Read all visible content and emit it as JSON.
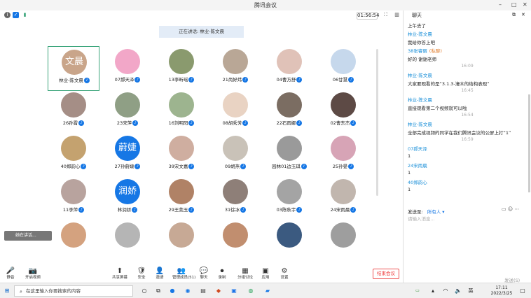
{
  "window": {
    "title": "腾讯会议"
  },
  "header": {
    "timer": "01:56:54",
    "speaking": "正在讲话: 林业-陈文晨"
  },
  "participants": [
    {
      "name": "林业-陈文晨",
      "avatar_text": "文晨",
      "selected": true
    },
    {
      "name": "07郝天泽",
      "avatar_text": ""
    },
    {
      "name": "13李昕瑶",
      "avatar_text": ""
    },
    {
      "name": "21尚好炜",
      "avatar_text": ""
    },
    {
      "name": "04曹方舒",
      "avatar_text": ""
    },
    {
      "name": "06甘慧",
      "avatar_text": ""
    },
    {
      "name": "26孙霄",
      "avatar_text": ""
    },
    {
      "name": "23宋萍",
      "avatar_text": ""
    },
    {
      "name": "16刘明阳",
      "avatar_text": ""
    },
    {
      "name": "08胡秀芳",
      "avatar_text": ""
    },
    {
      "name": "22石雨娜",
      "avatar_text": ""
    },
    {
      "name": "02曹东杰",
      "avatar_text": ""
    },
    {
      "name": "40郑韵心",
      "avatar_text": ""
    },
    {
      "name": "27孙蔚婕",
      "avatar_text": "蔚婕"
    },
    {
      "name": "39宋文嘉",
      "avatar_text": ""
    },
    {
      "name": "09胡燕",
      "avatar_text": ""
    },
    {
      "name": "园林01边玉琪",
      "avatar_text": ""
    },
    {
      "name": "25孙晏",
      "avatar_text": ""
    },
    {
      "name": "11李萍",
      "avatar_text": ""
    },
    {
      "name": "林润娇",
      "avatar_text": "润娇"
    },
    {
      "name": "29王莞玉",
      "avatar_text": ""
    },
    {
      "name": "31徐冰",
      "avatar_text": ""
    },
    {
      "name": "03陈秋宇",
      "avatar_text": ""
    },
    {
      "name": "24宋雨晨",
      "avatar_text": ""
    },
    {
      "name": "",
      "avatar_text": ""
    },
    {
      "name": "",
      "avatar_text": ""
    },
    {
      "name": "",
      "avatar_text": ""
    },
    {
      "name": "",
      "avatar_text": ""
    },
    {
      "name": "",
      "avatar_text": ""
    },
    {
      "name": "",
      "avatar_text": ""
    }
  ],
  "avatar_colors": [
    "#c9a58a",
    "#f2a7c8",
    "#8a9a6e",
    "#b9a796",
    "#e0c2b8",
    "#c6d8ec",
    "#a58e86",
    "#8f9f85",
    "#9db48f",
    "#e9d3c3",
    "#7b6d62",
    "#5d4a45",
    "#c4a26f",
    "#1677e5",
    "#cfaea0",
    "#c9c2b8",
    "#9a9a9a",
    "#d7a4b6",
    "#b8a39e",
    "#1677e5",
    "#b08266",
    "#8e7f78",
    "#a4a4a4",
    "#c1b6ae",
    "#d4a27f",
    "#b5b5b5",
    "#c7a995",
    "#c18e6f",
    "#3b5a80",
    "#9e9e9e"
  ],
  "pip_label": "她在讲话...",
  "toolbar": {
    "mute": "静音",
    "video": "开启视频",
    "share": "共享屏幕",
    "security": "安全",
    "invite": "邀请",
    "members": "管理成员(51)",
    "chat": "聊天",
    "record": "录制",
    "rooms": "分组讨论",
    "apps": "应用",
    "settings": "设置",
    "end": "结束会议"
  },
  "chat": {
    "title": "聊天",
    "messages": [
      {
        "kind": "text",
        "text": "上午去了"
      },
      {
        "kind": "sender",
        "text": "林业-陈文晨"
      },
      {
        "kind": "text",
        "text": "我给你答上吧"
      },
      {
        "kind": "sender",
        "text": "38张睿丽",
        "private": "(私聊)"
      },
      {
        "kind": "text",
        "text": "好的 谢谢老师"
      },
      {
        "kind": "time",
        "text": "16:09"
      },
      {
        "kind": "sender",
        "text": "林业-陈文晨"
      },
      {
        "kind": "text",
        "text": "大家要观看的是“3.1.3-濠木的结构表现”"
      },
      {
        "kind": "time",
        "text": "16:45"
      },
      {
        "kind": "sender",
        "text": "林业-陈文晨"
      },
      {
        "kind": "text",
        "text": "直接观看第二个视频就可以啦"
      },
      {
        "kind": "time",
        "text": "16:54"
      },
      {
        "kind": "sender",
        "text": "林业-陈文晨"
      },
      {
        "kind": "text",
        "text": "全部完成视频的同学在我们腾讯会议的公屏上打“1”"
      },
      {
        "kind": "time",
        "text": "16:59"
      },
      {
        "kind": "sender",
        "text": "07郝天泽"
      },
      {
        "kind": "text",
        "text": "1"
      },
      {
        "kind": "sender",
        "text": "24宋雨晨"
      },
      {
        "kind": "text",
        "text": "1"
      },
      {
        "kind": "sender",
        "text": "40郑韵心"
      },
      {
        "kind": "text",
        "text": "1"
      }
    ],
    "send_to_label": "发送至:",
    "send_to_target": "所有人 ▾",
    "input_placeholder": "请输入消息...",
    "send_label": "发送(S)"
  },
  "taskbar": {
    "search_placeholder": "在这里输入你要搜索的内容",
    "time": "17:11",
    "date": "2022/3/25"
  }
}
